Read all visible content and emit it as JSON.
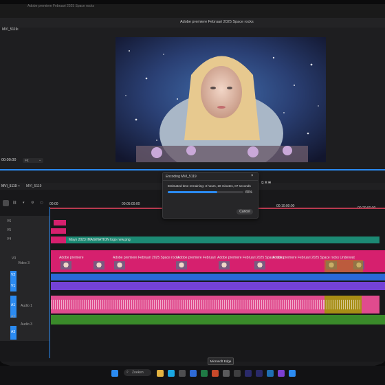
{
  "app": {
    "top_title": "Adobe premiere Februari 2025 Space rocks",
    "window_hint": "Adobe premiere Februari 2025 Space rocks"
  },
  "source_panel": {
    "clip_name": "MVI_5119",
    "timecode": "00:00:00",
    "fit_select": "Fit"
  },
  "program_monitor": {
    "title": "Adobe premiere Februari 2025 Space rocks",
    "image_description_icon": "video-frame"
  },
  "encoding_dialog": {
    "title": "Encoding MVI_5119",
    "status": "Estimated time remaining: 3 hours, 10 minutes, 07 seconds",
    "percent": "65%",
    "progress": 0.65,
    "cancel_label": "Cancel"
  },
  "timeline": {
    "sequence_name": "MVI_5119",
    "ruler": [
      "00:00",
      "00:05:00:00",
      "00:10:00:00",
      "00:20:00:00"
    ],
    "video_tracks": [
      "V6",
      "V5",
      "V4",
      "V3",
      "V2",
      "V1"
    ],
    "video3_name": "Video 3",
    "audio_tracks": [
      "A1",
      "A2",
      "A3"
    ],
    "audio1_name": "Audio 1",
    "audio3_name": "Audio 3",
    "clips": {
      "v4_clip": "Mayn 2023 IMAGINATION logo new.png",
      "v3_title_1": "Adobe premiere",
      "v3_title_2": "Adobe premiere Februari 2025 Space rocks",
      "v3_title_3": "Adobe premiere Februari",
      "v3_title_4": "Adobe premiere Februari 2025 Space rocks",
      "v3_title_5": "Adobe premiere Februari 2025 Space rocks Underwat"
    }
  },
  "taskbar": {
    "search_placeholder": "Zoeken",
    "tooltip": "Microsoft Edge"
  },
  "colors": {
    "accent_blue": "#2b8bf2",
    "clip_pink": "#d6206e",
    "clip_teal": "#1c8a74",
    "clip_blue": "#2b69d8",
    "clip_purple": "#7442d6",
    "clip_green": "#3a8a2a"
  }
}
